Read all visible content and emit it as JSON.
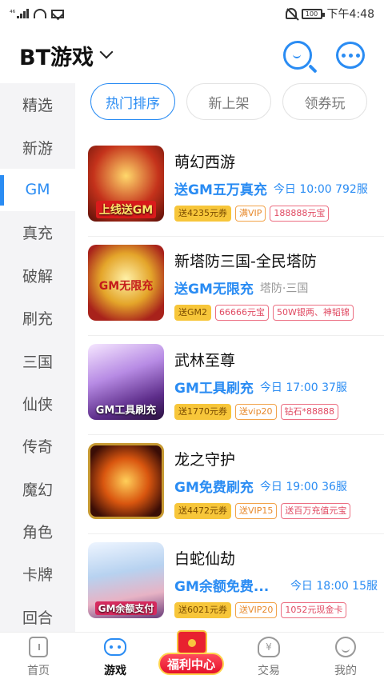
{
  "status_bar": {
    "signal_label": "⁴⁶",
    "time": "下午4:48",
    "battery": "100"
  },
  "header": {
    "title": "BT游戏",
    "search_icon": "search-icon",
    "message_icon": "message-icon"
  },
  "sidebar": {
    "items": [
      {
        "label": "精选"
      },
      {
        "label": "新游"
      },
      {
        "label": "GM"
      },
      {
        "label": "真充"
      },
      {
        "label": "破解"
      },
      {
        "label": "刷充"
      },
      {
        "label": "三国"
      },
      {
        "label": "仙侠"
      },
      {
        "label": "传奇"
      },
      {
        "label": "魔幻"
      },
      {
        "label": "角色"
      },
      {
        "label": "卡牌"
      },
      {
        "label": "回合"
      }
    ],
    "active_index": 2
  },
  "tabs": [
    {
      "label": "热门排序"
    },
    {
      "label": "新上架"
    },
    {
      "label": "领券玩"
    }
  ],
  "games": [
    {
      "name": "萌幻西游",
      "promo": "送GM五万真充",
      "meta": "今日 10:00 792服",
      "thumb_text": "上线送GM",
      "tags": [
        "送4235元券",
        "满VIP",
        "188888元宝"
      ]
    },
    {
      "name": "新塔防三国-全民塔防",
      "promo": "送GM无限充",
      "meta": "塔防·三国",
      "thumb_text": "GM无限充",
      "tags": [
        "送GM2",
        "66666元宝",
        "50W银两、神韬锦"
      ]
    },
    {
      "name": "武林至尊",
      "promo": "GM工具刷充",
      "meta": "今日 17:00 37服",
      "thumb_text": "GM工具刷充",
      "tags": [
        "送1770元券",
        "送vip20",
        "钻石*88888"
      ]
    },
    {
      "name": "龙之守护",
      "promo": "GM免费刷充",
      "meta": "今日 19:00 36服",
      "thumb_text": "",
      "tags": [
        "送4472元券",
        "送VIP15",
        "送百万充值元宝"
      ]
    },
    {
      "name": "白蛇仙劫",
      "promo": "GM余额免费...",
      "meta": "今日 18:00 15服",
      "thumb_text": "GM余额支付",
      "tags": [
        "送6021元券",
        "送VIP20",
        "1052元现金卡"
      ]
    }
  ],
  "bottom_nav": [
    {
      "label": "首页"
    },
    {
      "label": "游戏"
    },
    {
      "label": "交易"
    },
    {
      "label": "我的"
    }
  ],
  "welfare": {
    "label": "福利中心"
  },
  "colors": {
    "accent": "#2a8cf3",
    "tag_gold": "#f7c63a",
    "tag_red": "#e04a62",
    "tag_orange": "#e7892b"
  }
}
